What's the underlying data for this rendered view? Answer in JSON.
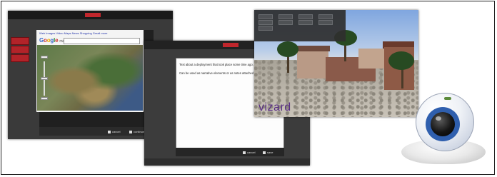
{
  "window_map": {
    "google_links": "Web  Images  Video  Maps  News  Shopping  Gmail  more",
    "logo_text": "Google maps",
    "cancel_label": "cancel",
    "ok_label": "continue"
  },
  "window_text": {
    "line1": "Text about a deployment that took place some time ago.",
    "line2": "Can be used as narrative elements or as notes attached",
    "cancel_label": "cancel",
    "save_label": "save"
  },
  "window_3d": {
    "brand": "vizard"
  }
}
